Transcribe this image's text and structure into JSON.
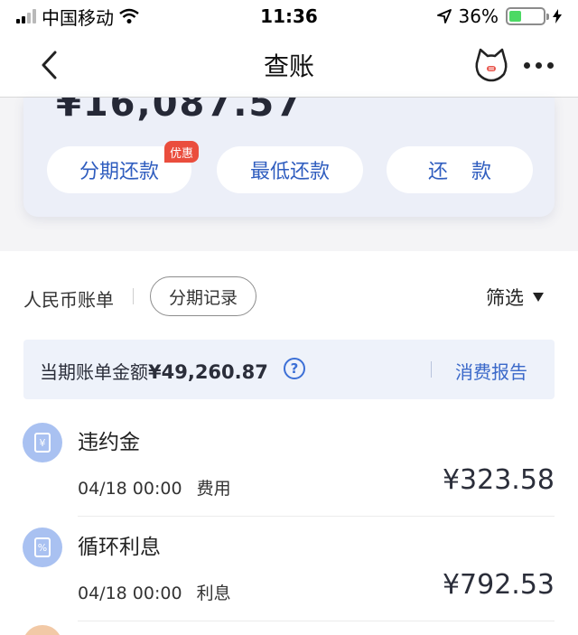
{
  "status_bar": {
    "carrier": "中国移动",
    "time": "11:36",
    "battery_percent": "36%",
    "battery_level": 0.36
  },
  "nav": {
    "title": "查账",
    "back_icon": "chevron-left-icon",
    "mascot_icon": "cat-mascot-icon",
    "more_icon": "more-icon"
  },
  "bill": {
    "amount": "¥16,087.57",
    "buttons": {
      "installment": "分期还款",
      "minimum": "最低还款",
      "repay": "还款"
    },
    "promo_badge": "优惠"
  },
  "filters": {
    "rmb_bill": "人民币账单",
    "installment_records": "分期记录",
    "filter": "筛选"
  },
  "summary": {
    "label": "当期账单金额",
    "amount": "¥49,260.87",
    "help_icon": "?",
    "report_link": "消费报告"
  },
  "transactions": [
    {
      "title": "违约金",
      "date": "04/18 00:00",
      "category": "费用",
      "amount": "¥323.58",
      "icon": "yen-doc-icon",
      "icon_glyph": "¥"
    },
    {
      "title": "循环利息",
      "date": "04/18 00:00",
      "category": "利息",
      "amount": "¥792.53",
      "icon": "percent-doc-icon",
      "icon_glyph": "%"
    }
  ],
  "colors": {
    "accent": "#2f5dbf",
    "icon_bg": "#a9c1f1",
    "badge": "#ea4d3d",
    "card_bg": "#eceff8"
  }
}
